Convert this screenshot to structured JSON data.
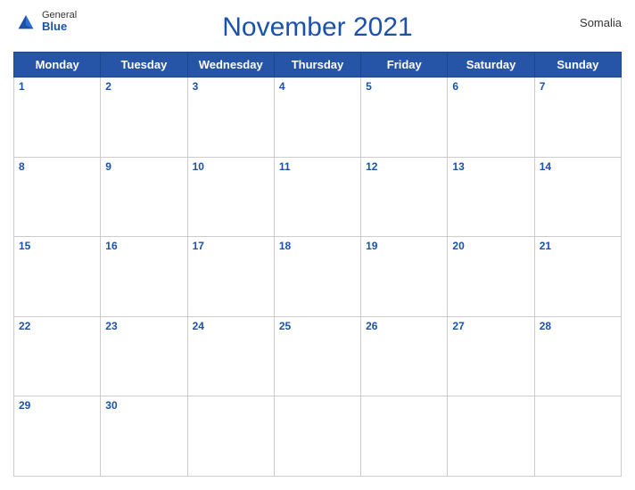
{
  "header": {
    "title": "November 2021",
    "country": "Somalia",
    "logo_general": "General",
    "logo_blue": "Blue"
  },
  "weekdays": [
    "Monday",
    "Tuesday",
    "Wednesday",
    "Thursday",
    "Friday",
    "Saturday",
    "Sunday"
  ],
  "weeks": [
    [
      1,
      2,
      3,
      4,
      5,
      6,
      7
    ],
    [
      8,
      9,
      10,
      11,
      12,
      13,
      14
    ],
    [
      15,
      16,
      17,
      18,
      19,
      20,
      21
    ],
    [
      22,
      23,
      24,
      25,
      26,
      27,
      28
    ],
    [
      29,
      30,
      null,
      null,
      null,
      null,
      null
    ]
  ]
}
